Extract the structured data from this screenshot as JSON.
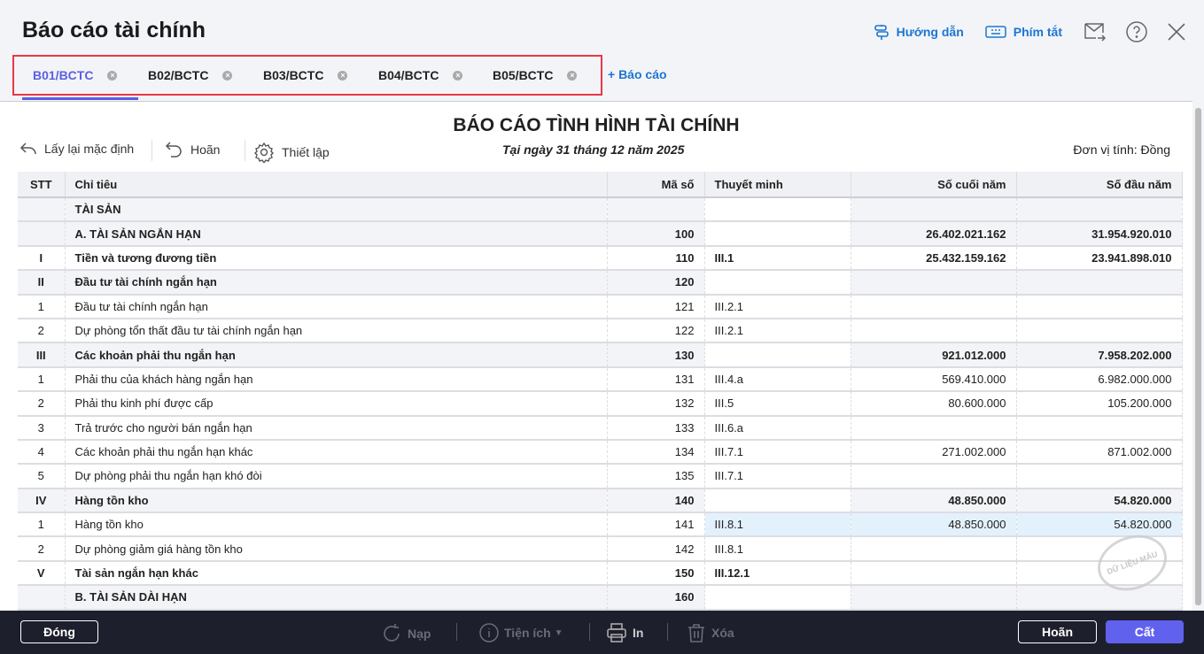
{
  "header": {
    "title": "Báo cáo tài chính",
    "guide": "Hướng dẫn",
    "shortcuts": "Phím tắt"
  },
  "tabs": [
    {
      "label": "B01/BCTC"
    },
    {
      "label": "B02/BCTC"
    },
    {
      "label": "B03/BCTC"
    },
    {
      "label": "B04/BCTC"
    },
    {
      "label": "B05/BCTC"
    }
  ],
  "add_report": "+ Báo cáo",
  "toolbar": {
    "reset": "Lấy lại mặc định",
    "undo": "Hoãn",
    "settings": "Thiết lập"
  },
  "report": {
    "title": "BÁO CÁO TÌNH HÌNH TÀI CHÍNH",
    "date": "Tại ngày 31 tháng 12 năm 2025",
    "unit": "Đơn vị tính: Đồng"
  },
  "columns": [
    "STT",
    "Chỉ tiêu",
    "Mã số",
    "Thuyết minh",
    "Số cuối năm",
    "Số đầu năm"
  ],
  "rows": [
    [
      "",
      "TÀI SẢN",
      "",
      "",
      "",
      ""
    ],
    [
      "",
      "A. TÀI SẢN NGẮN HẠN",
      "100",
      "",
      "26.402.021.162",
      "31.954.920.010"
    ],
    [
      "I",
      "Tiền và tương đương tiền",
      "110",
      "III.1",
      "25.432.159.162",
      "23.941.898.010"
    ],
    [
      "II",
      "Đầu tư tài chính ngắn hạn",
      "120",
      "",
      "",
      ""
    ],
    [
      "1",
      "Đầu tư tài chính ngắn hạn",
      "121",
      "III.2.1",
      "",
      ""
    ],
    [
      "2",
      "Dự phòng tổn thất đầu tư tài chính ngắn hạn",
      "122",
      "III.2.1",
      "",
      ""
    ],
    [
      "III",
      "Các khoản phải thu ngắn hạn",
      "130",
      "",
      "921.012.000",
      "7.958.202.000"
    ],
    [
      "1",
      "Phải thu của khách hàng ngắn hạn",
      "131",
      "III.4.a",
      "569.410.000",
      "6.982.000.000"
    ],
    [
      "2",
      "Phải thu kinh phí được cấp",
      "132",
      "III.5",
      "80.600.000",
      "105.200.000"
    ],
    [
      "3",
      "Trả trước cho người bán ngắn hạn",
      "133",
      "III.6.a",
      "",
      ""
    ],
    [
      "4",
      "Các khoản phải thu ngắn hạn khác",
      "134",
      "III.7.1",
      "271.002.000",
      "871.002.000"
    ],
    [
      "5",
      "Dự phòng phải thu ngắn hạn khó đòi",
      "135",
      "III.7.1",
      "",
      ""
    ],
    [
      "IV",
      "Hàng tồn kho",
      "140",
      "",
      "48.850.000",
      "54.820.000"
    ],
    [
      "1",
      "Hàng tồn kho",
      "141",
      "III.8.1",
      "48.850.000",
      "54.820.000"
    ],
    [
      "2",
      "Dự phòng giảm giá hàng tồn kho",
      "142",
      "III.8.1",
      "",
      ""
    ],
    [
      "V",
      "Tài sản ngắn hạn khác",
      "150",
      "III.12.1",
      "",
      ""
    ],
    [
      "",
      "B. TÀI SẢN DÀI HẠN",
      "160",
      "",
      "",
      ""
    ]
  ],
  "row_styles": [
    "g",
    "g",
    "b",
    "g",
    "",
    "",
    "g",
    "",
    "",
    "",
    "",
    "",
    "g",
    "sel",
    "",
    "b",
    "g"
  ],
  "stamp": "DỮ LIỆU MẪU",
  "footer": {
    "close": "Đóng",
    "load": "Nạp",
    "utilities": "Tiện ích",
    "print": "In",
    "delete": "Xóa",
    "cancel": "Hoãn",
    "save": "Cất"
  }
}
